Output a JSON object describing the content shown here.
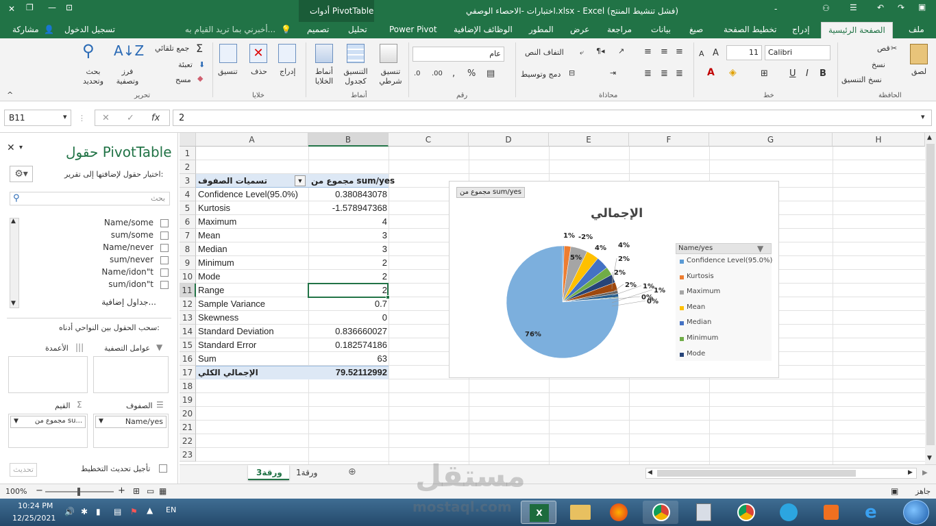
{
  "app": {
    "window_title": "اختبارات -الاحصاء الوصفي.xlsx - Excel (فشل تنشيط المنتج)",
    "context_tools": "أدوات PivotTable",
    "accent": "#217346"
  },
  "tabs": [
    "ملف",
    "الصفحة الرئيسية",
    "إدراج",
    "تخطيط الصفحة",
    "صيغ",
    "بيانات",
    "مراجعة",
    "عرض",
    "المطور",
    "الوظائف الإضافية",
    "Power Pivot",
    "تحليل",
    "تصميم"
  ],
  "tell_me": "أخبرني بما تريد القيام به...",
  "sign_in": "تسجيل الدخول",
  "share": "مشاركة",
  "ribbon": {
    "clipboard": {
      "label": "الحافظة",
      "paste": "لصق",
      "cut": "قص",
      "copy": "نسخ",
      "format_painter": "نسخ التنسيق"
    },
    "font": {
      "label": "خط",
      "name": "Calibri",
      "size": "11"
    },
    "alignment": {
      "label": "محاذاة",
      "wrap": "التفاف النص",
      "merge": "دمج وتوسيط"
    },
    "number": {
      "label": "رقم",
      "format": "عام"
    },
    "styles": {
      "label": "أنماط",
      "conditional": "تنسيق شرطي",
      "as_table": "التنسيق كجدول",
      "cell_styles": "أنماط الخلايا"
    },
    "cells": {
      "label": "خلايا",
      "insert": "إدراج",
      "delete": "حذف",
      "format": "تنسيق"
    },
    "editing": {
      "label": "تحرير",
      "autosum": "جمع تلقائي",
      "fill": "تعبئة",
      "clear": "مسح",
      "sort": "فرز وتصفية",
      "find": "بحث وتحديد"
    }
  },
  "formula_bar": {
    "name_box": "B11",
    "fx": "fx",
    "value": "2"
  },
  "pivot_pane": {
    "title": "حقول PivotTable",
    "choose_fields": "اختيار حقول لإضافتها إلى تقرير:",
    "search_placeholder": "بحث",
    "fields": [
      "Name/some",
      "sum/some",
      "Name/never",
      "sum/never",
      "Name/idon\"t",
      "sum/idon\"t"
    ],
    "more_tables": "جداول إضافية...",
    "drag_hint": "سحب الحقول بين النواحي أدناه:",
    "filters": "عوامل التصفية",
    "columns": "الأعمدة",
    "rows": "الصفوف",
    "values": "القيم",
    "rows_item": "Name/yes",
    "values_item": "مجموع من su...",
    "defer": "تأجيل تحديث التخطيط",
    "update": "تحديث"
  },
  "grid": {
    "columns": [
      "A",
      "B",
      "C",
      "D",
      "E",
      "F",
      "G",
      "H"
    ],
    "rows": [
      "1",
      "2",
      "3",
      "4",
      "5",
      "6",
      "7",
      "8",
      "9",
      "10",
      "11",
      "12",
      "13",
      "14",
      "15",
      "16",
      "17",
      "18",
      "19",
      "20",
      "21",
      "22",
      "23"
    ],
    "header_a": "تسميات الصفوف",
    "header_b": "مجموع من sum/yes",
    "data": [
      [
        "Confidence Level(95.0%)",
        "0.380843078"
      ],
      [
        "Kurtosis",
        "-1.578947368"
      ],
      [
        "Maximum",
        "4"
      ],
      [
        "Mean",
        "3"
      ],
      [
        "Median",
        "3"
      ],
      [
        "Minimum",
        "2"
      ],
      [
        "Mode",
        "2"
      ],
      [
        "Range",
        "2"
      ],
      [
        "Sample Variance",
        "0.7"
      ],
      [
        "Skewness",
        "0"
      ],
      [
        "Standard Deviation",
        "0.836660027"
      ],
      [
        "Standard Error",
        "0.182574186"
      ],
      [
        "Sum",
        "63"
      ]
    ],
    "total_label": "الإجمالي الكلي",
    "total_value": "79.52112992"
  },
  "chart_data": {
    "type": "pie",
    "field_button": "مجموع من sum/yes",
    "title": "الإجمالي",
    "legend_title": "Name/yes",
    "legend_placement": "right",
    "categories": [
      "Confidence Level(95.0%)",
      "Kurtosis",
      "Maximum",
      "Mean",
      "Median",
      "Minimum",
      "Mode",
      "Range",
      "Sample Variance",
      "Skewness",
      "Standard Deviation",
      "Standard Error",
      "Sum"
    ],
    "legend_visible": [
      "Confidence Level(95.0%)",
      "Kurtosis",
      "Maximum",
      "Mean",
      "Median",
      "Minimum",
      "Mode"
    ],
    "values": [
      0.380843078,
      -1.578947368,
      4,
      3,
      3,
      2,
      2,
      2,
      0.7,
      0,
      0.836660027,
      0.182574186,
      63
    ],
    "data_labels": [
      "1%",
      "-2%",
      "5%",
      "4%",
      "4%",
      "2%",
      "2%",
      "2%",
      "1%",
      "0%",
      "1%",
      "0%",
      "76%"
    ],
    "colors": [
      "#5b9bd5",
      "#ed7d31",
      "#a5a5a5",
      "#ffc000",
      "#4472c4",
      "#70ad47",
      "#264478",
      "#9e480e",
      "#636363",
      "#997300",
      "#255e91",
      "#43682b",
      "#7cafdd"
    ]
  },
  "sheet_tabs": [
    "ورقة3",
    "ورقة1"
  ],
  "status": {
    "ready": "جاهز",
    "zoom": "100%"
  },
  "taskbar": {
    "time": "10:24 PM",
    "date": "12/25/2021",
    "lang": "EN"
  },
  "watermark": {
    "arabic": "مستقل",
    "latin": "mostaql.com"
  }
}
